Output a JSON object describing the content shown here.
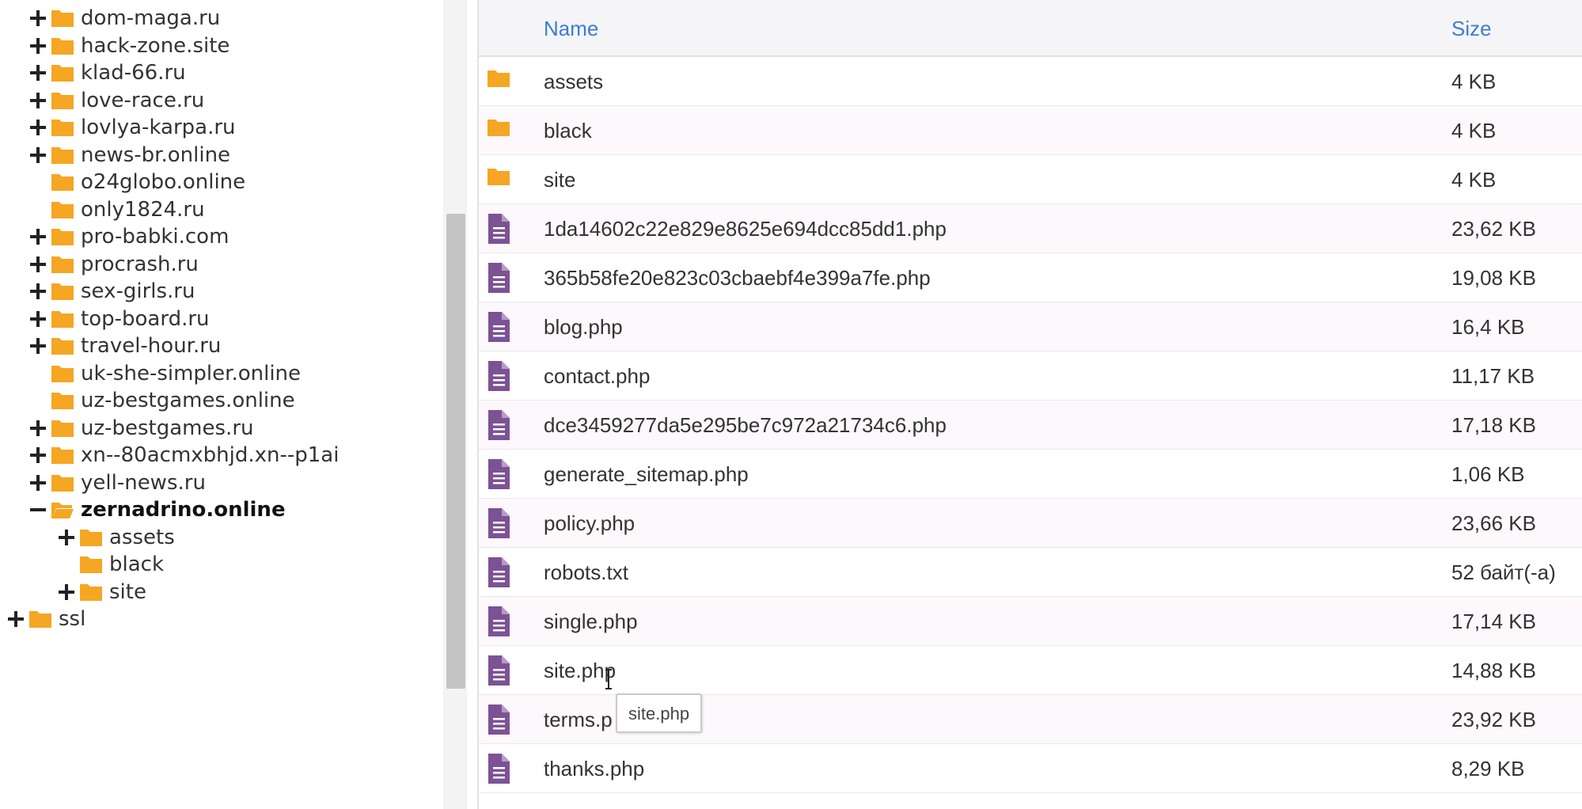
{
  "tree": {
    "items": [
      {
        "label": "dom-maga.ru",
        "toggle": "plus",
        "level": 1,
        "open": false,
        "bold": false
      },
      {
        "label": "hack-zone.site",
        "toggle": "plus",
        "level": 1,
        "open": false,
        "bold": false
      },
      {
        "label": "klad-66.ru",
        "toggle": "plus",
        "level": 1,
        "open": false,
        "bold": false
      },
      {
        "label": "love-race.ru",
        "toggle": "plus",
        "level": 1,
        "open": false,
        "bold": false
      },
      {
        "label": "lovlya-karpa.ru",
        "toggle": "plus",
        "level": 1,
        "open": false,
        "bold": false
      },
      {
        "label": "news-br.online",
        "toggle": "plus",
        "level": 1,
        "open": false,
        "bold": false
      },
      {
        "label": "o24globo.online",
        "toggle": "none",
        "level": 1,
        "open": false,
        "bold": false
      },
      {
        "label": "only1824.ru",
        "toggle": "none",
        "level": 1,
        "open": false,
        "bold": false
      },
      {
        "label": "pro-babki.com",
        "toggle": "plus",
        "level": 1,
        "open": false,
        "bold": false
      },
      {
        "label": "procrash.ru",
        "toggle": "plus",
        "level": 1,
        "open": false,
        "bold": false
      },
      {
        "label": "sex-girls.ru",
        "toggle": "plus",
        "level": 1,
        "open": false,
        "bold": false
      },
      {
        "label": "top-board.ru",
        "toggle": "plus",
        "level": 1,
        "open": false,
        "bold": false
      },
      {
        "label": "travel-hour.ru",
        "toggle": "plus",
        "level": 1,
        "open": false,
        "bold": false
      },
      {
        "label": "uk-she-simpler.online",
        "toggle": "none",
        "level": 1,
        "open": false,
        "bold": false
      },
      {
        "label": "uz-bestgames.online",
        "toggle": "none",
        "level": 1,
        "open": false,
        "bold": false
      },
      {
        "label": "uz-bestgames.ru",
        "toggle": "plus",
        "level": 1,
        "open": false,
        "bold": false
      },
      {
        "label": "xn--80acmxbhjd.xn--p1ai",
        "toggle": "plus",
        "level": 1,
        "open": false,
        "bold": false
      },
      {
        "label": "yell-news.ru",
        "toggle": "plus",
        "level": 1,
        "open": false,
        "bold": false
      },
      {
        "label": "zernadrino.online",
        "toggle": "minus",
        "level": 1,
        "open": true,
        "bold": true
      },
      {
        "label": "assets",
        "toggle": "plus",
        "level": 2,
        "open": false,
        "bold": false
      },
      {
        "label": "black",
        "toggle": "none",
        "level": 2,
        "open": false,
        "bold": false
      },
      {
        "label": "site",
        "toggle": "plus",
        "level": 2,
        "open": false,
        "bold": false
      },
      {
        "label": "ssl",
        "toggle": "plus",
        "level": 0,
        "open": false,
        "bold": false
      }
    ]
  },
  "table": {
    "name_header": "Name",
    "size_header": "Size",
    "rows": [
      {
        "name": "assets",
        "size": "4 KB",
        "type": "folder"
      },
      {
        "name": "black",
        "size": "4 KB",
        "type": "folder"
      },
      {
        "name": "site",
        "size": "4 KB",
        "type": "folder"
      },
      {
        "name": "1da14602c22e829e8625e694dcc85dd1.php",
        "size": "23,62 KB",
        "type": "file"
      },
      {
        "name": "365b58fe20e823c03cbaebf4e399a7fe.php",
        "size": "19,08 KB",
        "type": "file"
      },
      {
        "name": "blog.php",
        "size": "16,4 KB",
        "type": "file"
      },
      {
        "name": "contact.php",
        "size": "11,17 KB",
        "type": "file"
      },
      {
        "name": "dce3459277da5e295be7c972a21734c6.php",
        "size": "17,18 KB",
        "type": "file"
      },
      {
        "name": "generate_sitemap.php",
        "size": "1,06 KB",
        "type": "file"
      },
      {
        "name": "policy.php",
        "size": "23,66 KB",
        "type": "file"
      },
      {
        "name": "robots.txt",
        "size": "52 байт(-а)",
        "type": "file"
      },
      {
        "name": "single.php",
        "size": "17,14 KB",
        "type": "file"
      },
      {
        "name": "site.php",
        "size": "14,88 KB",
        "type": "file"
      },
      {
        "name": "terms.p",
        "size": "23,92 KB",
        "type": "file"
      },
      {
        "name": "thanks.php",
        "size": "8,29 KB",
        "type": "file"
      }
    ]
  },
  "tooltip": {
    "text": "site.php"
  },
  "colors": {
    "folder": "#f5a623",
    "file_icon": "#7c5295",
    "header_link": "#3d7cd3",
    "row_alt": "#fcf8fb"
  },
  "icons": {
    "folder": "folder-icon",
    "folder_open": "folder-open-icon",
    "file": "file-document-icon",
    "expand": "plus-icon",
    "collapse": "minus-icon"
  }
}
